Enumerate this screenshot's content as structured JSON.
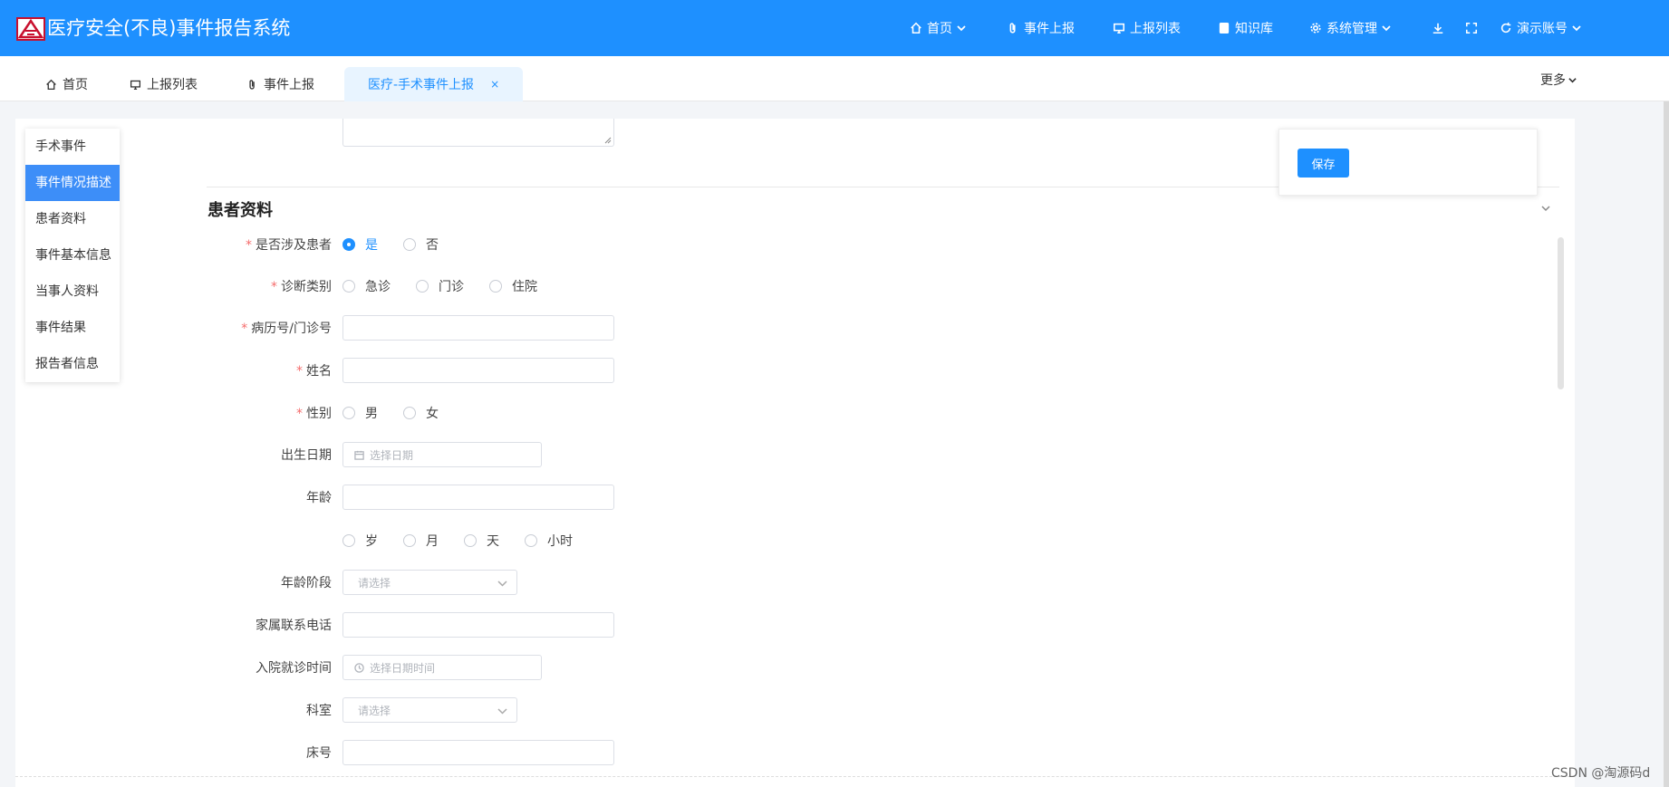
{
  "header": {
    "app_title": "医疗安全(不良)事件报告系统",
    "nav": [
      {
        "label": "首页",
        "icon": "home-icon"
      },
      {
        "label": "事件上报",
        "icon": "paperclip-icon"
      },
      {
        "label": "上报列表",
        "icon": "monitor-icon"
      },
      {
        "label": "知识库",
        "icon": "book-icon"
      },
      {
        "label": "系统管理",
        "icon": "gear-icon"
      }
    ],
    "account_label": "演示账号"
  },
  "tabs": [
    {
      "label": "首页",
      "icon": "home-icon"
    },
    {
      "label": "上报列表",
      "icon": "monitor-icon"
    },
    {
      "label": "事件上报",
      "icon": "paperclip-icon"
    },
    {
      "label": "医疗-手术事件上报",
      "active": true
    }
  ],
  "tabs_more": "更多",
  "anchor_nav": [
    {
      "label": "手术事件"
    },
    {
      "label": "事件情况描述",
      "active": true
    },
    {
      "label": "患者资料"
    },
    {
      "label": "事件基本信息"
    },
    {
      "label": "当事人资料"
    },
    {
      "label": "事件结果"
    },
    {
      "label": "报告者信息"
    }
  ],
  "save_label": "保存",
  "section_title": "患者资料",
  "form": {
    "involves_patient": {
      "label": "是否涉及患者",
      "required": true,
      "options": [
        "是",
        "否"
      ],
      "selected": "是"
    },
    "diagnosis_type": {
      "label": "诊断类别",
      "required": true,
      "options": [
        "急诊",
        "门诊",
        "住院"
      ]
    },
    "record_no": {
      "label": "病历号/门诊号",
      "required": true,
      "value": ""
    },
    "name": {
      "label": "姓名",
      "required": true,
      "value": ""
    },
    "gender": {
      "label": "性别",
      "required": true,
      "options": [
        "男",
        "女"
      ]
    },
    "birth_date": {
      "label": "出生日期",
      "placeholder": "选择日期"
    },
    "age": {
      "label": "年龄",
      "value": ""
    },
    "age_unit": {
      "options": [
        "岁",
        "月",
        "天",
        "小时"
      ]
    },
    "age_stage": {
      "label": "年龄阶段",
      "placeholder": "请选择"
    },
    "family_phone": {
      "label": "家属联系电话",
      "value": ""
    },
    "admission_time": {
      "label": "入院就诊时间",
      "placeholder": "选择日期时间"
    },
    "department": {
      "label": "科室",
      "placeholder": "请选择"
    },
    "bed_no": {
      "label": "床号",
      "value": ""
    }
  },
  "watermark": "CSDN @淘源码d",
  "colors": {
    "primary": "#1e90ff",
    "required": "#f56c6c",
    "anchor_active": "#3d8ef8"
  }
}
